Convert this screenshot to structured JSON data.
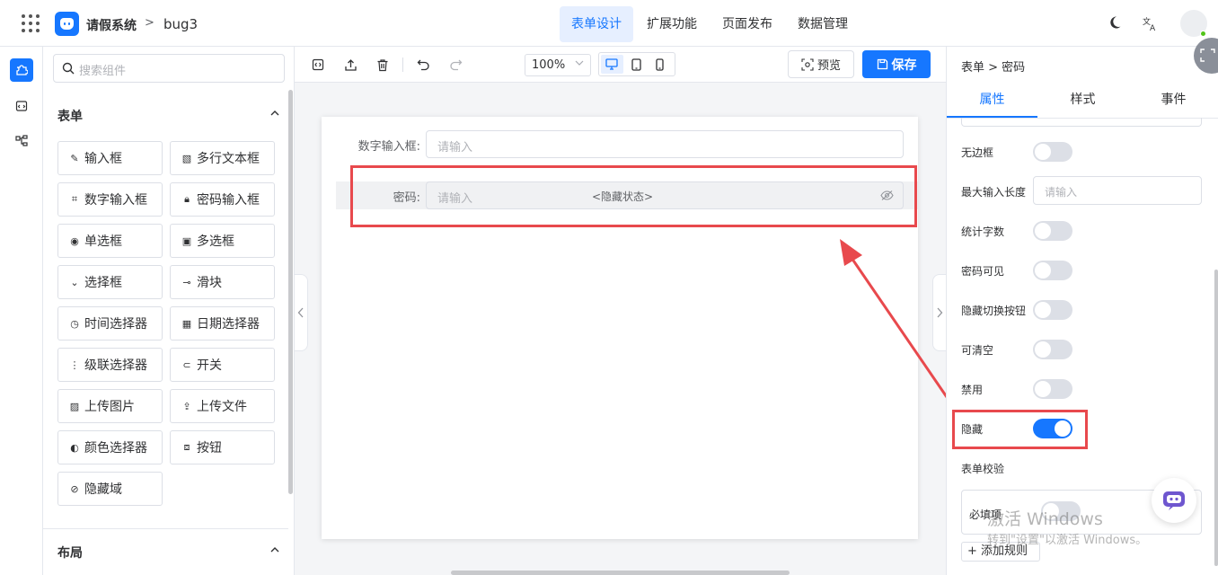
{
  "header": {
    "app_name": "请假系统",
    "separator": ">",
    "project": "bug3",
    "nav": [
      {
        "label": "表单设计",
        "active": true
      },
      {
        "label": "扩展功能",
        "active": false
      },
      {
        "label": "页面发布",
        "active": false
      },
      {
        "label": "数据管理",
        "active": false
      }
    ],
    "icons": [
      "moon-icon",
      "translate-icon",
      "avatar"
    ]
  },
  "rail": {
    "icons": [
      "puzzle-icon",
      "code-icon",
      "tree-icon"
    ]
  },
  "components": {
    "search_placeholder": "搜索组件",
    "form_section": "表单",
    "items": [
      {
        "label": "输入框",
        "icon": "edit-icon"
      },
      {
        "label": "多行文本框",
        "icon": "textarea-icon"
      },
      {
        "label": "数字输入框",
        "icon": "number-icon"
      },
      {
        "label": "密码输入框",
        "icon": "lock-icon"
      },
      {
        "label": "单选框",
        "icon": "radio-icon"
      },
      {
        "label": "多选框",
        "icon": "checkbox-icon"
      },
      {
        "label": "选择框",
        "icon": "select-icon"
      },
      {
        "label": "滑块",
        "icon": "slider-icon"
      },
      {
        "label": "时间选择器",
        "icon": "clock-icon"
      },
      {
        "label": "日期选择器",
        "icon": "calendar-icon"
      },
      {
        "label": "级联选择器",
        "icon": "cascader-icon"
      },
      {
        "label": "开关",
        "icon": "switch-icon"
      },
      {
        "label": "上传图片",
        "icon": "image-icon"
      },
      {
        "label": "上传文件",
        "icon": "upload-icon"
      },
      {
        "label": "颜色选择器",
        "icon": "palette-icon"
      },
      {
        "label": "按钮",
        "icon": "button-icon"
      },
      {
        "label": "隐藏域",
        "icon": "eye-off-icon"
      }
    ],
    "layout_section": "布局"
  },
  "toolbar": {
    "zoom": "100%",
    "preview": "预览",
    "save": "保存"
  },
  "canvas": {
    "fields": [
      {
        "label": "数字输入框:",
        "placeholder": "请输入"
      },
      {
        "label": "密码:",
        "placeholder": "请输入",
        "hidden_tag": "<隐藏状态>"
      }
    ]
  },
  "props": {
    "breadcrumb": "表单 > 密码",
    "tabs": [
      {
        "label": "属性",
        "active": true
      },
      {
        "label": "样式",
        "active": false
      },
      {
        "label": "事件",
        "active": false
      }
    ],
    "rows": [
      {
        "label": "无边框",
        "type": "switch",
        "on": false
      },
      {
        "label": "最大输入长度",
        "type": "input",
        "placeholder": "请输入"
      },
      {
        "label": "统计字数",
        "type": "switch",
        "on": false
      },
      {
        "label": "密码可见",
        "type": "switch",
        "on": false
      },
      {
        "label": "隐藏切换按钮",
        "type": "switch",
        "on": false
      },
      {
        "label": "可清空",
        "type": "switch",
        "on": false
      },
      {
        "label": "禁用",
        "type": "switch",
        "on": false
      },
      {
        "label": "隐藏",
        "type": "switch",
        "on": true
      }
    ],
    "validation_title": "表单校验",
    "required_label": "必填项",
    "add_rule": "+ 添加规则"
  },
  "watermark": {
    "line1": "激活 Windows",
    "line2": "转到\"设置\"以激活 Windows。"
  },
  "colors": {
    "primary": "#1677ff",
    "highlight": "#e8494d"
  }
}
